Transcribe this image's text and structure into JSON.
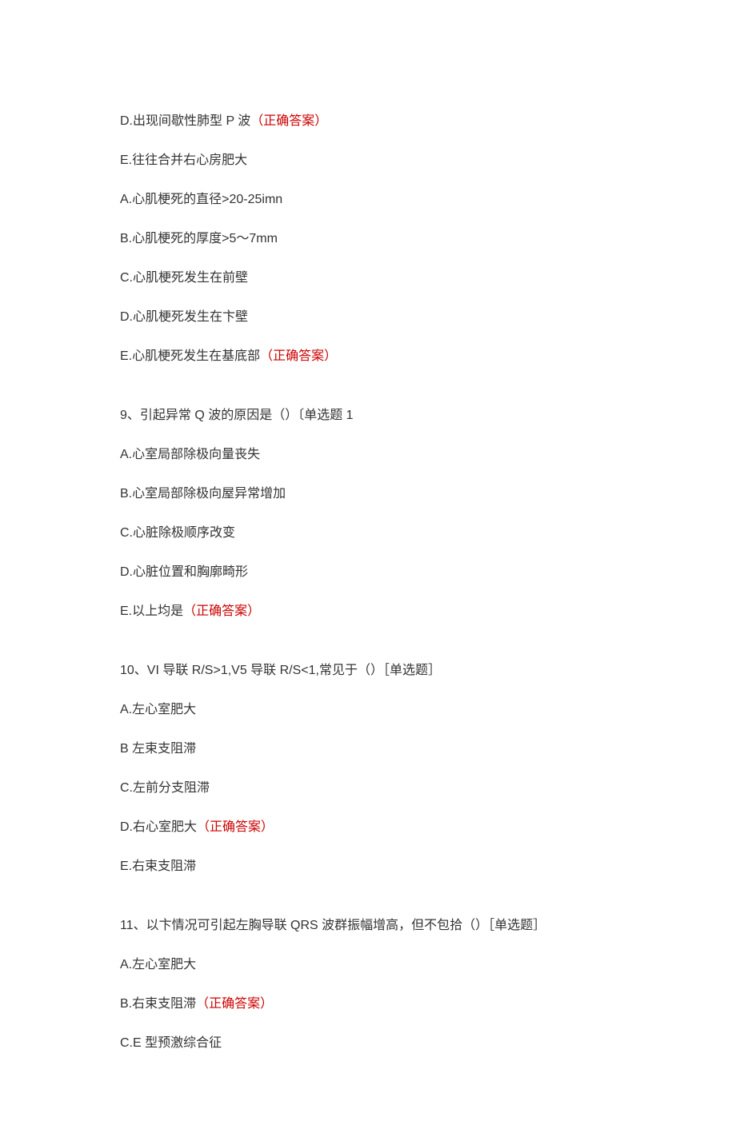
{
  "lines": {
    "l1_pre": "D.出现间歇性肺型 P 波",
    "l1_ans": "（正确答案）",
    "l2": "E.往往合并右心房肥大",
    "l3": "A.心肌梗死的直径>20-25imn",
    "l4": "B.心肌梗死的厚度>5～7mm",
    "l5": "C.心肌梗死发生在前壁",
    "l6": "D.心肌梗死发生在卞壁",
    "l7_pre": "E.心肌梗死发生在基底部",
    "l7_ans": "（正确答案）",
    "q9": "9、引起异常 Q 波的原因是（）〔单选题 1",
    "q9a": "A.心室局部除极向量丧失",
    "q9b": "B.心室局部除极向屋异常增加",
    "q9c": "C.心脏除极顺序改变",
    "q9d": "D.心脏位置和胸廓畸形",
    "q9e_pre": "E.以上均是",
    "q9e_ans": "（正确答案）",
    "q10": "10、VI 导联 R/S>1,V5 导联 R/S<1,常见于（）［单选题］",
    "q10a": "A.左心室肥大",
    "q10b": "B 左束支阻滞",
    "q10c": "C.左前分支阻滞",
    "q10d_pre": "D.右心室肥大",
    "q10d_ans": "（正确答案）",
    "q10e": "E.右束支阻滞",
    "q11": "11、以卞情况可引起左胸导联 QRS 波群振幅增高，但不包拾（）［单选题］",
    "q11a": "A.左心室肥大",
    "q11b_pre": "B.右束支阻滞",
    "q11b_ans": "（正确答案）",
    "q11c": "C.E 型预激综合征"
  }
}
